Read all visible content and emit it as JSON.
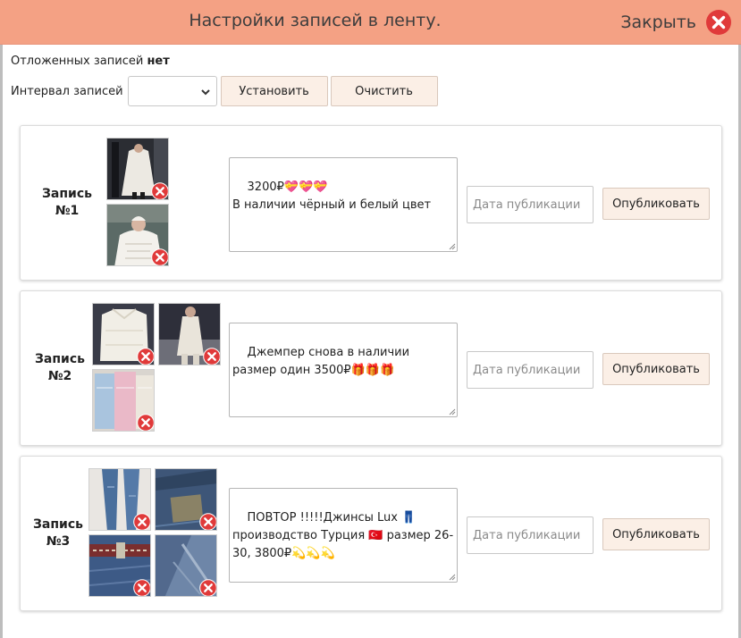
{
  "header": {
    "title": "Настройки записей в ленту.",
    "close_label": "Закрыть",
    "close_icon": "close-circle-icon",
    "bg_color": "#f4a184"
  },
  "toolbar": {
    "pending_label": "Отложенных записей",
    "pending_value": "нет",
    "interval_label": "Интервал записей",
    "interval_value": "",
    "set_button": "Установить",
    "clear_button": "Очистить"
  },
  "posts": [
    {
      "label": "Запись №1",
      "text": "3200₽💝💝💝\nВ наличии чёрный и белый цвет",
      "images": [
        "photo-cardigan-mirror",
        "photo-white-sweater-woman"
      ],
      "date_placeholder": "Дата публикации",
      "publish_button": "Опубликовать"
    },
    {
      "label": "Запись №2",
      "text": "Джемпер снова в наличии размер один 3500₽🎁🎁🎁",
      "images": [
        "photo-white-jumper",
        "photo-woman-light-outfit",
        "photo-pastel-jumpers"
      ],
      "date_placeholder": "Дата публикации",
      "publish_button": "Опубликовать"
    },
    {
      "label": "Запись №3",
      "text": "ПОВТОР !!!!!Джинсы Lux 👖\nпроизводство Турция 🇹🇷 размер 26-30, 3800₽💫💫💫",
      "images": [
        "photo-jeans-legs",
        "photo-jeans-label",
        "photo-jeans-belt",
        "photo-jeans-fabric"
      ],
      "date_placeholder": "Дата публикации",
      "publish_button": "Опубликовать"
    }
  ],
  "colors": {
    "accent": "#f4a184",
    "button_bg": "#fbefe6",
    "delete_red": "#e03a3a"
  }
}
